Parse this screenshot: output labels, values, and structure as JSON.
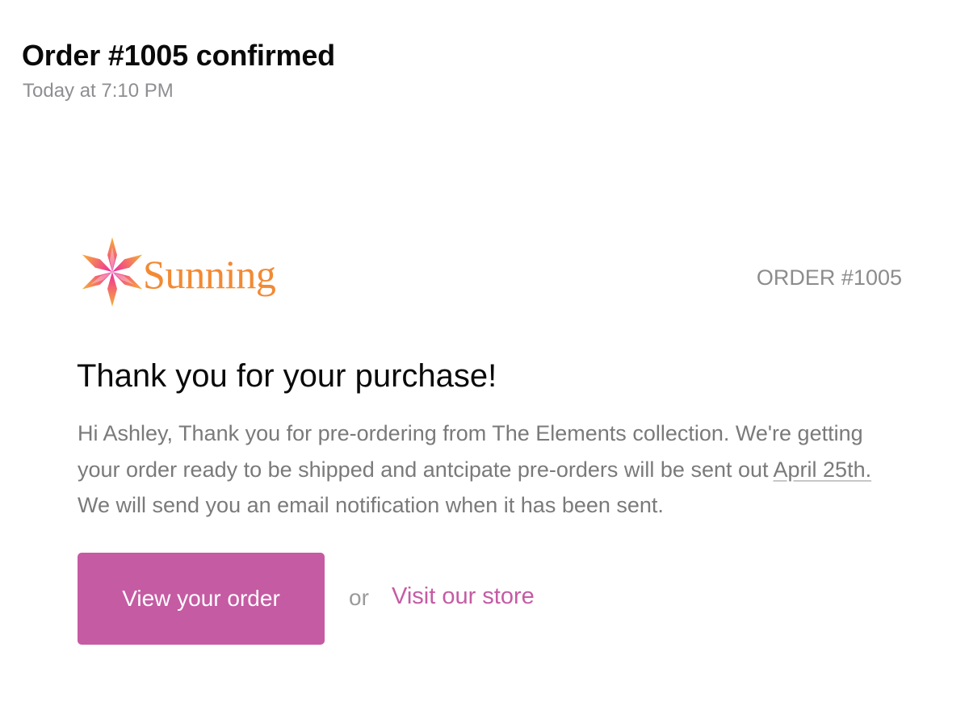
{
  "email": {
    "subject": "Order #1005 confirmed",
    "timestamp": "Today at 7:10 PM"
  },
  "brand": {
    "name": "Sunning",
    "logo_icon": "six-point-star-icon",
    "colors": {
      "gradient_top": "#f7b034",
      "gradient_middle": "#f36d6a",
      "gradient_bottom": "#ee2a9f",
      "text": "#f28a34"
    }
  },
  "order": {
    "number_label": "ORDER #1005"
  },
  "message": {
    "heading": "Thank you for your purchase!",
    "body_before": "Hi Ashley, Thank you for pre-ordering from The Elements collection. We're getting your order ready to be shipped and antcipate pre-orders will be sent out ",
    "body_date": "April 25th.",
    "body_after": " We will send you an email notification when it has been sent."
  },
  "actions": {
    "view_order_label": "View your order",
    "or_label": "or",
    "visit_store_label": "Visit our store",
    "accent_color": "#c55ba3"
  }
}
